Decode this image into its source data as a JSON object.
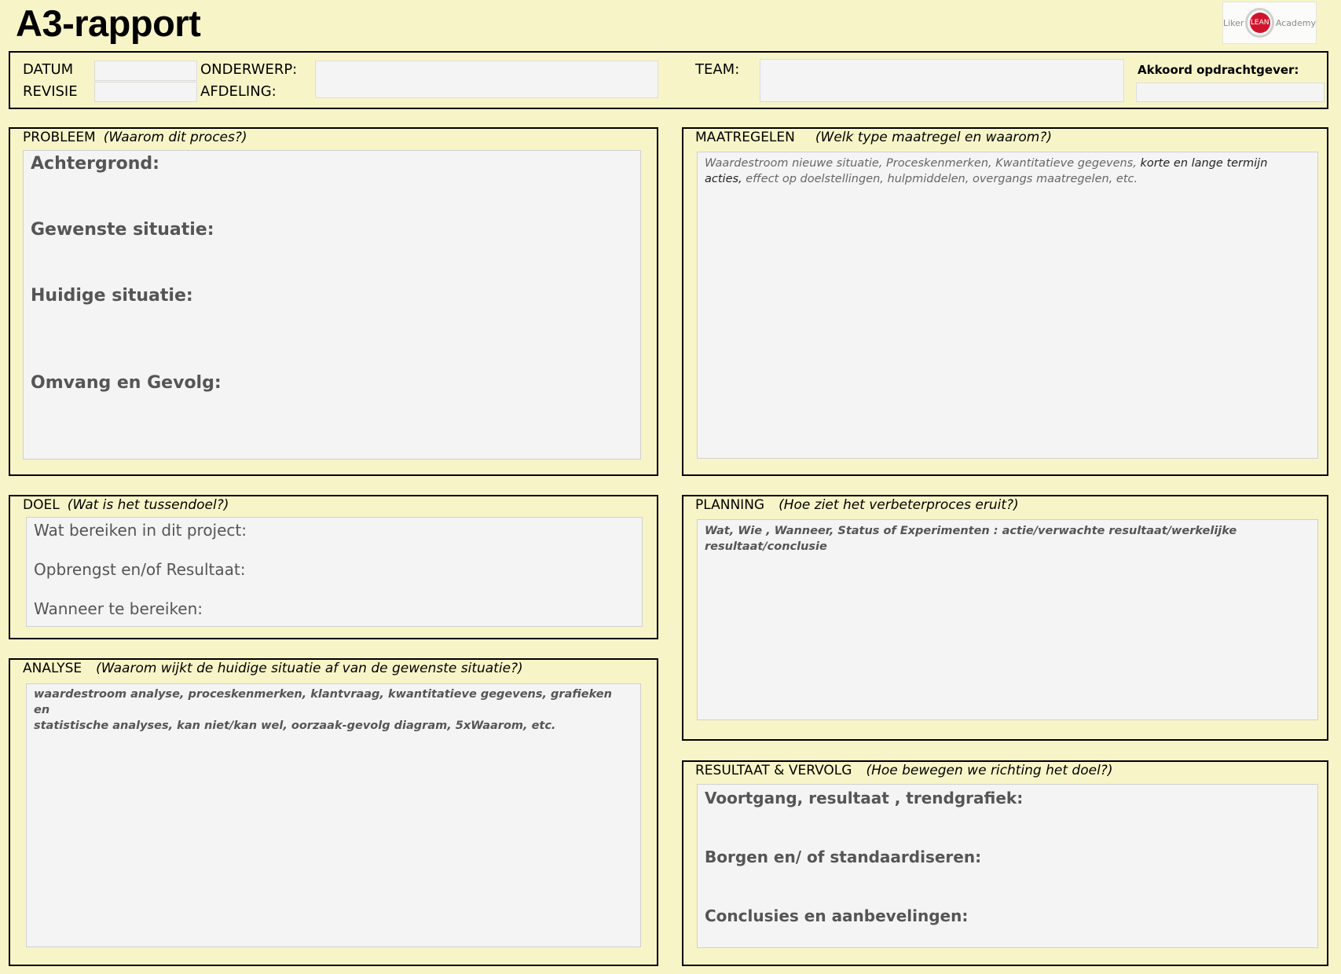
{
  "title": "A3-rapport",
  "logo": {
    "left": "Liker",
    "mark": "LEAN",
    "right": "Academy"
  },
  "header": {
    "datum": "DATUM",
    "revisie": "REVISIE",
    "onderwerp": "ONDERWERP:",
    "afdeling": "AFDELING:",
    "team": "TEAM:",
    "akkoord": "Akkoord opdrachtgever:"
  },
  "probleem": {
    "label": "PROBLEEM",
    "sub": "(Waarom dit proces?)",
    "items": [
      "Achtergrond:",
      "Gewenste situatie:",
      "Huidige  situatie:",
      "Omvang en Gevolg:"
    ]
  },
  "maatregelen": {
    "label": "MAATREGELEN",
    "sub": "(Welk type maatregel en waarom?)",
    "hint_a": "Waardestroom nieuwe situatie, Proceskenmerken, Kwantitatieve gegevens,",
    "hint_b": " korte  en lange termijn",
    "hint_c": "acties,",
    "hint_d": "  effect op doelstellingen, hulpmiddelen, overgangs maatregelen, etc."
  },
  "doel": {
    "label": "DOEL",
    "sub": "(Wat is het tussendoel?)",
    "items": [
      "Wat bereiken in dit project:",
      "Opbrengst en/of Resultaat:",
      "Wanneer te bereiken:"
    ]
  },
  "planning": {
    "label": "PLANNING",
    "sub": "(Hoe ziet het verbeterproces eruit?)",
    "hint_1": "Wat, Wie , Wanneer, Status of Experimenten : actie/verwachte resultaat/werkelijke",
    "hint_2": "resultaat/conclusie"
  },
  "analyse": {
    "label": "ANALYSE",
    "sub": "(Waarom wijkt de huidige situatie af van de gewenste situatie?)",
    "hint_1": "waardestroom analyse, proceskenmerken, klantvraag, kwantitatieve gegevens, grafieken en",
    "hint_2": "statistische analyses, kan niet/kan wel, oorzaak-gevolg diagram, 5xWaarom, etc."
  },
  "resultaat": {
    "label": "RESULTAAT & VERVOLG",
    "sub": "(Hoe bewegen we richting het doel?)",
    "items": [
      "Voortgang, resultaat  , trendgrafiek:",
      "Borgen en/ of standaardiseren:",
      "Conclusies en aanbevelingen:"
    ]
  }
}
